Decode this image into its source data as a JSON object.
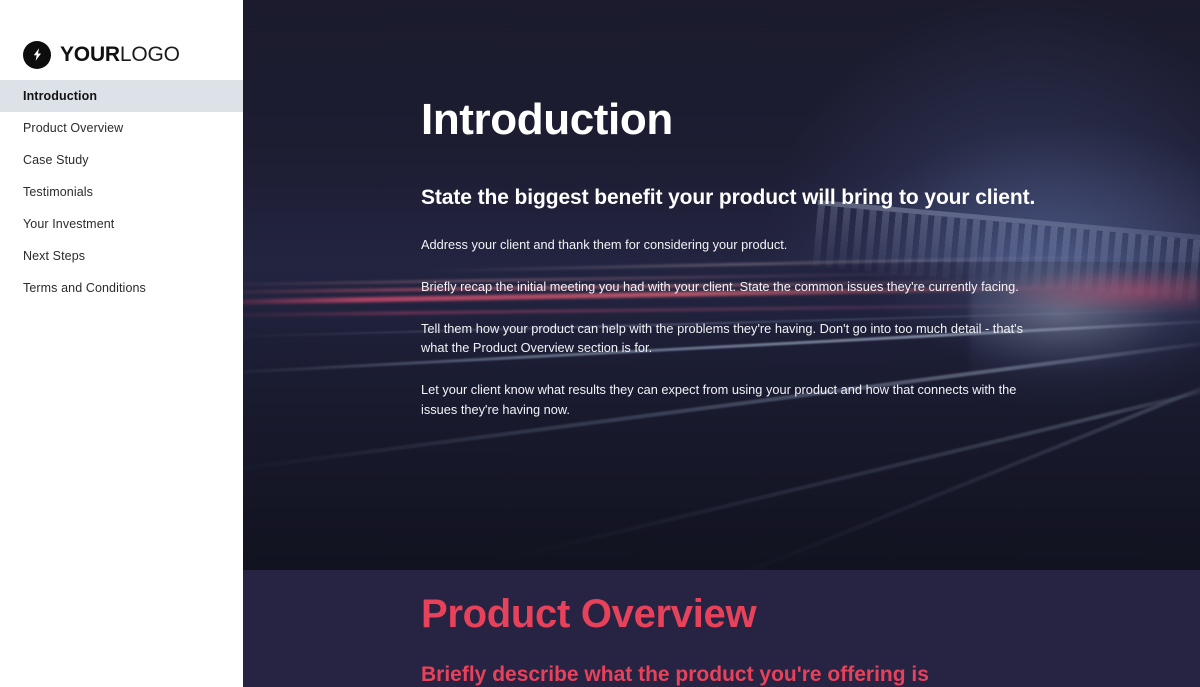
{
  "sidebar": {
    "logo": {
      "icon": "lightning-bolt-icon",
      "bold_part": "YOUR",
      "light_part": "LOGO"
    },
    "items": [
      {
        "label": "Introduction",
        "active": true
      },
      {
        "label": "Product Overview",
        "active": false
      },
      {
        "label": "Case Study",
        "active": false
      },
      {
        "label": "Testimonials",
        "active": false
      },
      {
        "label": "Your Investment",
        "active": false
      },
      {
        "label": "Next Steps",
        "active": false
      },
      {
        "label": "Terms and Conditions",
        "active": false
      }
    ]
  },
  "hero": {
    "title": "Introduction",
    "subtitle": "State the biggest benefit your product will bring to your client.",
    "paragraphs": [
      "Address your client and thank them for considering your product.",
      "Briefly recap the initial meeting you had with your client. State the common issues they're currently facing.",
      "Tell them how your product can help with the problems they're having. Don't go into too much detail - that's what the Product Overview section is for.",
      "Let your client know what results they can expect from using your product and how that connects with the issues they're having now."
    ]
  },
  "section_product_overview": {
    "title": "Product Overview",
    "subtitle": "Briefly describe what the product you're offering is"
  },
  "colors": {
    "accent_red": "#e8415a",
    "hero_background": "#1b1b2e",
    "section_background": "#272443",
    "sidebar_background": "#ffffff",
    "sidebar_active_background": "#dde1e8",
    "logo_mark": "#0d0d0d"
  }
}
